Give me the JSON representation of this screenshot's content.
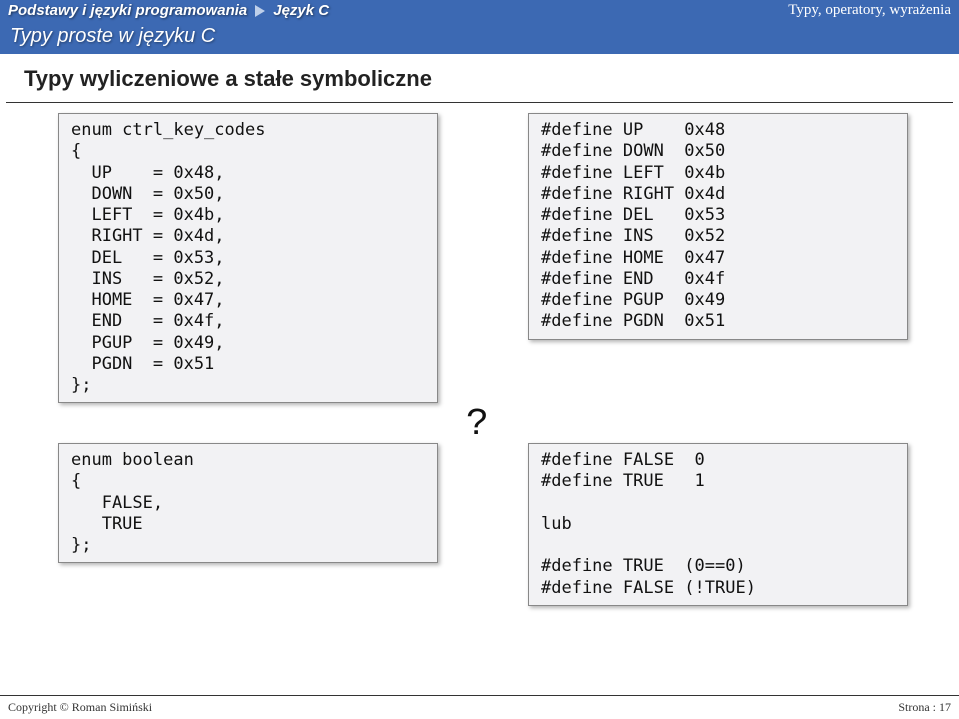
{
  "header": {
    "breadcrumb1": "Podstawy i języki programowania",
    "breadcrumb2": "Język C",
    "right": "Typy, operatory, wyrażenia"
  },
  "subheader": "Typy proste w języku C",
  "section_title": "Typy wyliczeniowe a stałe symboliczne",
  "code_enum_ctrl": "enum ctrl_key_codes\n{\n  UP    = 0x48,\n  DOWN  = 0x50,\n  LEFT  = 0x4b,\n  RIGHT = 0x4d,\n  DEL   = 0x53,\n  INS   = 0x52,\n  HOME  = 0x47,\n  END   = 0x4f,\n  PGUP  = 0x49,\n  PGDN  = 0x51\n};",
  "code_enum_bool": "enum boolean\n{\n   FALSE,\n   TRUE\n};",
  "code_defines_keys": "#define UP    0x48\n#define DOWN  0x50\n#define LEFT  0x4b\n#define RIGHT 0x4d\n#define DEL   0x53\n#define INS   0x52\n#define HOME  0x47\n#define END   0x4f\n#define PGUP  0x49\n#define PGDN  0x51",
  "code_defines_bool": "#define FALSE  0\n#define TRUE   1\n\nlub\n\n#define TRUE  (0==0)\n#define FALSE (!TRUE)",
  "question_mark": "?",
  "footer": {
    "copyright": "Copyright © Roman Simiński",
    "page": "Strona : 17"
  }
}
